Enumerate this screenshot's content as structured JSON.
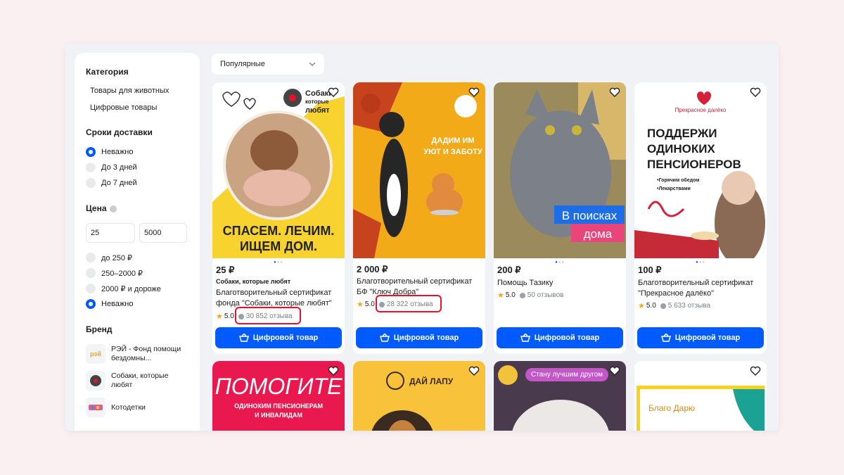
{
  "sort": {
    "label": "Популярные"
  },
  "sidebar": {
    "category_title": "Категория",
    "categories": [
      "Товары для животных",
      "Цифровые товары"
    ],
    "delivery_title": "Сроки доставки",
    "delivery_options": [
      {
        "label": "Неважно",
        "selected": true
      },
      {
        "label": "До 3 дней",
        "selected": false
      },
      {
        "label": "До 7 дней",
        "selected": false
      }
    ],
    "price_title": "Цена",
    "price_from": "25",
    "price_to": "5000",
    "price_options": [
      {
        "label": "до 250 ₽",
        "selected": false
      },
      {
        "label": "250–2000 ₽",
        "selected": false
      },
      {
        "label": "2000 ₽ и дороже",
        "selected": false
      },
      {
        "label": "Неважно",
        "selected": true
      }
    ],
    "brand_title": "Бренд",
    "brands": [
      {
        "label": "РЭЙ - Фонд помощи бездомны...",
        "logo": "рэй"
      },
      {
        "label": "Собаки, которые любят",
        "logo": ""
      },
      {
        "label": "Котодетки",
        "logo": ""
      }
    ]
  },
  "cards": [
    {
      "price": "25 ₽",
      "seller": "Собаки, которые любят",
      "title": "Благотворительный сертификат фонда \"Собаки, которые любят\"",
      "rating": "5.0",
      "reviews": "30 852 отзыва",
      "button": "Цифровой товар",
      "image_text": [
        "СПАСЕМ. ЛЕЧИМ.",
        "ИЩЕМ ДОМ."
      ],
      "logo_text": [
        "Собаки",
        "которые",
        "любят"
      ]
    },
    {
      "price": "2 000 ₽",
      "seller": "",
      "title": "Благотворительный сертификат БФ \"Ключ Добра\"",
      "rating": "5.0",
      "reviews": "28 322 отзыва",
      "button": "Цифровой товар",
      "image_text": [
        "ДАДИМ ИМ",
        "УЮТ И ЗАБОТУ"
      ]
    },
    {
      "price": "200 ₽",
      "seller": "",
      "title": "Помощь Тазику",
      "rating": "5.0",
      "reviews": "50 отзывов",
      "button": "Цифровой товар",
      "image_text": [
        "В поисках",
        "дома"
      ]
    },
    {
      "price": "100 ₽",
      "seller": "",
      "title": "Благотворительный сертификат \"Прекрасное далёко\"",
      "rating": "5.0",
      "reviews": "5 633 отзыва",
      "button": "Цифровой товар",
      "image_text": [
        "ПОДДЕРЖИ",
        "ОДИНОКИХ",
        "ПЕНСИОНЕРОВ"
      ],
      "image_sub": [
        "•Горячим обедом",
        "•Лекарствами"
      ],
      "logo_text": "Прекрасное далёко"
    }
  ],
  "row2": [
    {
      "image_text": [
        "ПОМОГИТЕ",
        "ОДИНОКИМ ПЕНСИОНЕРАМ",
        "И ИНВАЛИДАМ"
      ]
    },
    {
      "image_text": [
        "ДАЙ ЛАПУ"
      ]
    },
    {
      "image_text": [
        "Стану лучшим другом"
      ]
    },
    {
      "image_text": [
        "Благо Дарю"
      ]
    }
  ],
  "colors": {
    "accent": "#005bff",
    "highlight": "#e8112d",
    "star": "#f5a623"
  }
}
